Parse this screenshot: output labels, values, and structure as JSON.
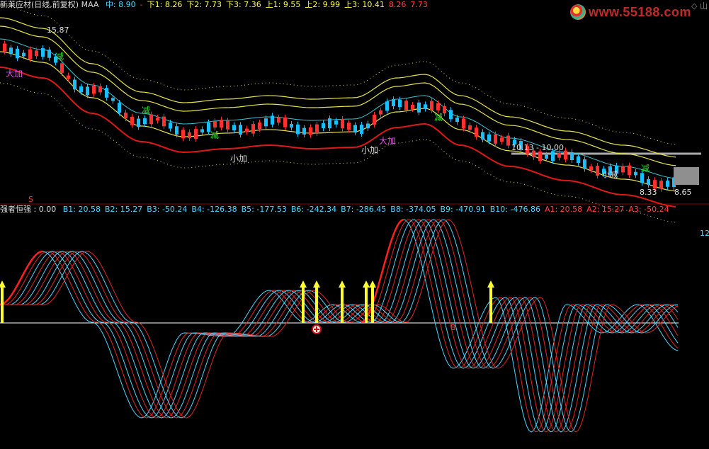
{
  "header_main": {
    "title": "新莱应材(日线,前复权) MAA",
    "items": [
      {
        "label": "中: 8.90",
        "color": "#4fd8ff"
      },
      {
        "label": "-",
        "color": "#ff4040"
      },
      {
        "label": "下1: 8.26",
        "color": "#ffff40"
      },
      {
        "label": "下2: 7.73",
        "color": "#ffff40"
      },
      {
        "label": "下3: 7.36",
        "color": "#ffff40"
      },
      {
        "label": "上1: 9.55",
        "color": "#ffff40"
      },
      {
        "label": "上2: 9.99",
        "color": "#ffff40"
      },
      {
        "label": "上3: 10.41",
        "color": "#ffff40"
      },
      {
        "label": "8.26",
        "color": "#ff4040"
      },
      {
        "label": "7.73",
        "color": "#ff4040"
      }
    ]
  },
  "header_sub": {
    "title": "强者恒强",
    "value": ": 0.00",
    "items": [
      {
        "label": "B1: 20.58",
        "color": "#4fd8ff"
      },
      {
        "label": "B2: 15.27",
        "color": "#4fd8ff"
      },
      {
        "label": "B3: -50.24",
        "color": "#4fd8ff"
      },
      {
        "label": "B4: -126.38",
        "color": "#4fd8ff"
      },
      {
        "label": "B5: -177.53",
        "color": "#4fd8ff"
      },
      {
        "label": "B6: -242.34",
        "color": "#4fd8ff"
      },
      {
        "label": "B7: -286.45",
        "color": "#4fd8ff"
      },
      {
        "label": "B8: -374.05",
        "color": "#4fd8ff"
      },
      {
        "label": "B9: -470.91",
        "color": "#4fd8ff"
      },
      {
        "label": "B10: -476.86",
        "color": "#4fd8ff"
      },
      {
        "label": "A1: 20.58",
        "color": "#ff4040"
      },
      {
        "label": "A2: 15.27",
        "color": "#ff4040"
      },
      {
        "label": "A3: -50.24",
        "color": "#ff4040"
      }
    ]
  },
  "logo": {
    "text": "www.55188.com"
  },
  "corner": {
    "label": "◇ 山"
  },
  "annotations": {
    "high": "15.87",
    "low_price": "8.33",
    "label_range": "10.13 - 10.00",
    "da_jia": "大加",
    "jian": "减",
    "xiao_jia": "小加",
    "s_mark": "S",
    "b_mark": "B",
    "right_axis_top": "12",
    "right_val": "8.65",
    "bottom_right_label": "小减"
  },
  "colors": {
    "up": "#ff3030",
    "down": "#19c0ff",
    "yellow": "#ffff30",
    "cyan": "#4fd8ff",
    "zero_line": "#ffffff"
  }
}
